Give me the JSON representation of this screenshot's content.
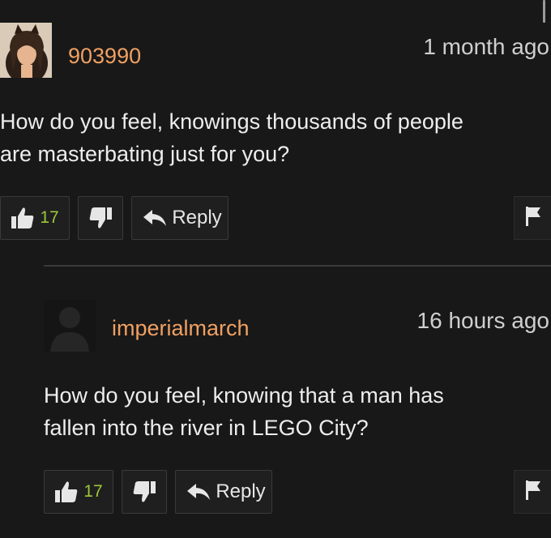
{
  "comments": [
    {
      "username": "903990",
      "timestamp": "1 month ago",
      "lines": [
        "How do you feel, knowings thousands of people",
        "are masterbating just for you?"
      ],
      "likes": "17",
      "reply_label": "Reply"
    },
    {
      "username": "imperialmarch",
      "timestamp": "16 hours ago",
      "lines": [
        "How do you feel, knowing that a man has",
        "fallen into the river in LEGO City?"
      ],
      "likes": "17",
      "reply_label": "Reply"
    }
  ],
  "colors": {
    "background": "#181818",
    "username": "#f0a062",
    "like_count": "#9bc73a",
    "button_bg": "#1f1f1f",
    "button_border": "#3a3a3a"
  },
  "icons": [
    "thumbs-up-icon",
    "thumbs-down-icon",
    "reply-arrow-icon",
    "flag-icon"
  ]
}
